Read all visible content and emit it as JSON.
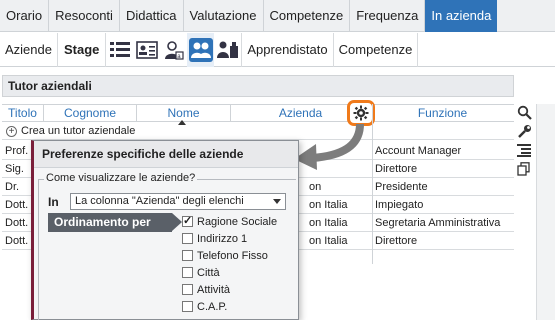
{
  "topnav": {
    "tabs": [
      {
        "label": "Orario"
      },
      {
        "label": "Resoconti"
      },
      {
        "label": "Didattica"
      },
      {
        "label": "Valutazione"
      },
      {
        "label": "Competenze"
      },
      {
        "label": "Frequenza"
      },
      {
        "label": "In azienda",
        "active": true
      }
    ]
  },
  "subnav": {
    "aziende": "Aziende",
    "stage": "Stage",
    "apprendistato": "Apprendistato",
    "competenze": "Competenze",
    "icons": [
      "list-icon",
      "id-card-icon",
      "person-badge-icon",
      "tutors-icon",
      "workers-icon"
    ]
  },
  "section": {
    "title": "Tutor aziendali"
  },
  "grid": {
    "columns": [
      "Titolo",
      "Cognome",
      "Nome",
      "Azienda",
      "Funzione"
    ],
    "create_label": "Crea un tutor aziendale",
    "rows": [
      {
        "titolo": "Prof.",
        "azienda": "",
        "funzione": "Account Manager"
      },
      {
        "titolo": "Sig.",
        "azienda": "",
        "funzione": "Direttore"
      },
      {
        "titolo": "Dr.",
        "azienda": "on",
        "funzione": "Presidente"
      },
      {
        "titolo": "Dott.",
        "azienda": "on Italia",
        "funzione": "Impiegato"
      },
      {
        "titolo": "Dott.",
        "azienda": "on Italia",
        "funzione": "Segretaria Amministrativa"
      },
      {
        "titolo": "Dott.",
        "azienda": "on Italia",
        "funzione": "Direttore"
      }
    ]
  },
  "popup": {
    "title": "Preferenze specifiche delle aziende",
    "legend": "Come visualizzare le aziende?",
    "in_label": "In",
    "select_value": "La colonna \"Azienda\" degli elenchi",
    "ordinamento_label": "Ordinamento per",
    "options": [
      {
        "label": "Ragione Sociale",
        "checked": true
      },
      {
        "label": "Indirizzo 1",
        "checked": false
      },
      {
        "label": "Telefono Fisso",
        "checked": false
      },
      {
        "label": "Città",
        "checked": false
      },
      {
        "label": "Attività",
        "checked": false
      },
      {
        "label": "C.A.P.",
        "checked": false
      }
    ]
  },
  "colors": {
    "accent": "#2f73b8",
    "highlight": "#f07a1a",
    "popup_border": "#7a1f3a"
  }
}
